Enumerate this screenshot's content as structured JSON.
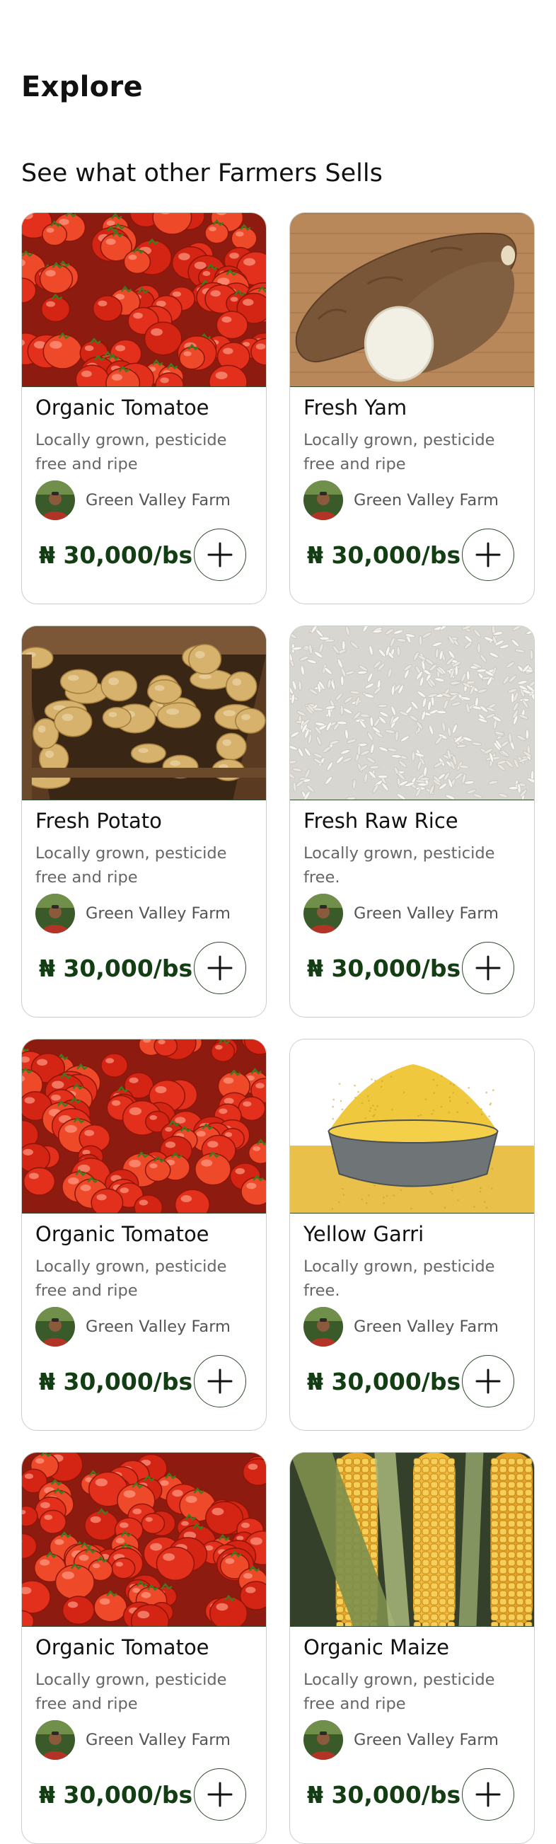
{
  "page": {
    "title": "Explore",
    "section_title": "See what other Farmers Sells"
  },
  "colors": {
    "price": "#133d12",
    "card_border": "#c9cfc7",
    "accent_border": "#2f4a2c",
    "description": "#666666",
    "seller": "#555555"
  },
  "products": [
    {
      "image": "tomatoes",
      "title": "Organic Tomatoe",
      "description": "Locally grown, pesticide free and ripe",
      "seller": "Green Valley Farm",
      "price": "₦ 30,000/bs",
      "add_icon": "plus-icon"
    },
    {
      "image": "yam",
      "title": "Fresh Yam",
      "description": "Locally grown, pesticide free and ripe",
      "seller": "Green Valley Farm",
      "price": "₦ 30,000/bs",
      "add_icon": "plus-icon"
    },
    {
      "image": "potatoes",
      "title": "Fresh Potato",
      "description": "Locally grown, pesticide free and ripe",
      "seller": "Green Valley Farm",
      "price": "₦ 30,000/bs",
      "add_icon": "plus-icon"
    },
    {
      "image": "rice",
      "title": "Fresh Raw Rice",
      "description": "Locally grown, pesticide free.",
      "seller": "Green Valley Farm",
      "price": "₦ 30,000/bs",
      "add_icon": "plus-icon"
    },
    {
      "image": "tomatoes",
      "title": "Organic Tomatoe",
      "description": "Locally grown, pesticide free and ripe",
      "seller": "Green Valley Farm",
      "price": "₦ 30,000/bs",
      "add_icon": "plus-icon"
    },
    {
      "image": "garri",
      "title": "Yellow Garri",
      "description": "Locally grown, pesticide free.",
      "seller": "Green Valley Farm",
      "price": "₦ 30,000/bs",
      "add_icon": "plus-icon"
    },
    {
      "image": "tomatoes",
      "title": "Organic Tomatoe",
      "description": "Locally grown, pesticide free and ripe",
      "seller": "Green Valley Farm",
      "price": "₦ 30,000/bs",
      "add_icon": "plus-icon"
    },
    {
      "image": "maize",
      "title": "Organic Maize",
      "description": "Locally grown, pesticide free and ripe",
      "seller": "Green Valley Farm",
      "price": "₦ 30,000/bs",
      "add_icon": "plus-icon"
    }
  ]
}
